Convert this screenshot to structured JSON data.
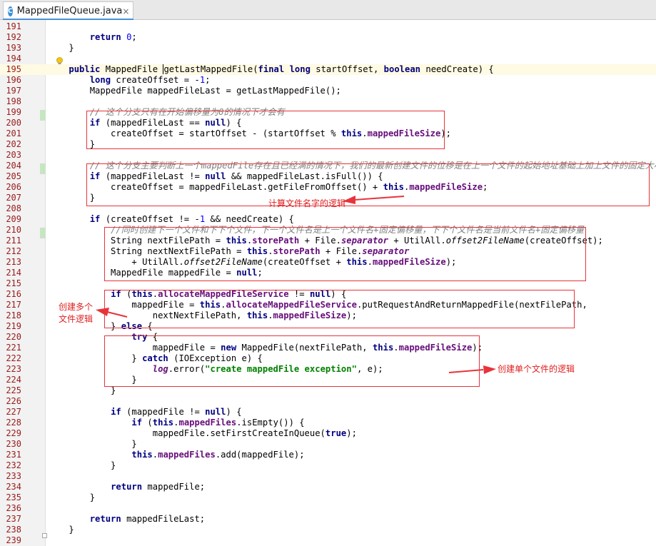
{
  "tab": {
    "label": "MappedFileQueue.java",
    "icon": "class-c-icon",
    "close": "×",
    "icon_letter": "C"
  },
  "colors": {
    "keyword": "#000080",
    "field": "#660e7a",
    "string": "#008000",
    "number": "#0000ff",
    "comment": "#808080",
    "annotation_red": "#e8333a"
  },
  "lines": [
    {
      "n": "191",
      "html": ""
    },
    {
      "n": "192",
      "html": "        <span class='kw'>return</span> <span class='num'>0</span>;"
    },
    {
      "n": "193",
      "html": "    }"
    },
    {
      "n": "194",
      "html": ""
    },
    {
      "n": "195",
      "html": "    <span class='kw'>public</span> MappedFile <span style='border-left:1px solid #000'>getLastMappedFile</span>(<span class='kw'>final long</span> startOffset, <span class='kw'>boolean</span> needCreate) {"
    },
    {
      "n": "196",
      "html": "        <span class='kw'>long</span> createOffset = -<span class='num'>1</span>;"
    },
    {
      "n": "197",
      "html": "        MappedFile mappedFileLast = getLastMappedFile();"
    },
    {
      "n": "198",
      "html": ""
    },
    {
      "n": "199",
      "html": "        <span class='cmt'>// 这个分支只有在开始偏移量为0的情况下才会有</span>"
    },
    {
      "n": "200",
      "html": "        <span class='kw'>if</span> (mappedFileLast == <span class='kw'>null</span>) {"
    },
    {
      "n": "201",
      "html": "            createOffset = startOffset - (startOffset % <span class='kw'>this</span>.<span class='fld'>mappedFileSize</span>);"
    },
    {
      "n": "202",
      "html": "        }"
    },
    {
      "n": "203",
      "html": ""
    },
    {
      "n": "204",
      "html": "        <span class='cmt'>// 这个分支主要判断上一个mappedFile存在且已经满的情况下，我们的最新创建文件的位移是在上一个文件的起始地址基础上加上文件的固定大小</span>"
    },
    {
      "n": "205",
      "html": "        <span class='kw'>if</span> (mappedFileLast != <span class='kw'>null</span> &amp;&amp; mappedFileLast.isFull()) {"
    },
    {
      "n": "206",
      "html": "            createOffset = mappedFileLast.getFileFromOffset() + <span class='kw'>this</span>.<span class='fld'>mappedFileSize</span>;"
    },
    {
      "n": "207",
      "html": "        }"
    },
    {
      "n": "208",
      "html": ""
    },
    {
      "n": "209",
      "html": "        <span class='kw'>if</span> (createOffset != -<span class='num'>1</span> &amp;&amp; needCreate) {"
    },
    {
      "n": "210",
      "html": "            <span class='cmt'>//同时创建下一个文件和下下个文件，下一个文件名是上一个文件名+固定偏移量，下下个文件名是当前文件名+固定偏移量</span>"
    },
    {
      "n": "211",
      "html": "            String nextFilePath = <span class='kw'>this</span>.<span class='fld'>storePath</span> + File.<span class='fld ital'>separator</span> + UtilAll.<span class='ital'>offset2FileName</span>(createOffset);"
    },
    {
      "n": "212",
      "html": "            String nextNextFilePath = <span class='kw'>this</span>.<span class='fld'>storePath</span> + File.<span class='fld ital'>separator</span>"
    },
    {
      "n": "213",
      "html": "                + UtilAll.<span class='ital'>offset2FileName</span>(createOffset + <span class='kw'>this</span>.<span class='fld'>mappedFileSize</span>);"
    },
    {
      "n": "214",
      "html": "            MappedFile mappedFile = <span class='kw'>null</span>;"
    },
    {
      "n": "215",
      "html": ""
    },
    {
      "n": "216",
      "html": "            <span class='kw'>if</span> (<span class='kw'>this</span>.<span class='fld'>allocateMappedFileService</span> != <span class='kw'>null</span>) {"
    },
    {
      "n": "217",
      "html": "                mappedFile = <span class='kw'>this</span>.<span class='fld'>allocateMappedFileService</span>.putRequestAndReturnMappedFile(nextFilePath,"
    },
    {
      "n": "218",
      "html": "                    nextNextFilePath, <span class='kw'>this</span>.<span class='fld'>mappedFileSize</span>);"
    },
    {
      "n": "219",
      "html": "            } <span class='kw'>else</span> {"
    },
    {
      "n": "220",
      "html": "                <span class='kw'>try</span> {"
    },
    {
      "n": "221",
      "html": "                    mappedFile = <span class='kw'>new</span> MappedFile(nextFilePath, <span class='kw'>this</span>.<span class='fld'>mappedFileSize</span>);"
    },
    {
      "n": "222",
      "html": "                } <span class='kw'>catch</span> (IOException e) {"
    },
    {
      "n": "223",
      "html": "                    <span class='fld ital'>log</span>.error(<span class='str'>\"create mappedFile exception\"</span>, e);"
    },
    {
      "n": "224",
      "html": "                }"
    },
    {
      "n": "225",
      "html": "            }"
    },
    {
      "n": "226",
      "html": ""
    },
    {
      "n": "227",
      "html": "            <span class='kw'>if</span> (mappedFile != <span class='kw'>null</span>) {"
    },
    {
      "n": "228",
      "html": "                <span class='kw'>if</span> (<span class='kw'>this</span>.<span class='fld'>mappedFiles</span>.isEmpty()) {"
    },
    {
      "n": "229",
      "html": "                    mappedFile.setFirstCreateInQueue(<span class='kw'>true</span>);"
    },
    {
      "n": "230",
      "html": "                }"
    },
    {
      "n": "231",
      "html": "                <span class='kw'>this</span>.<span class='fld'>mappedFiles</span>.add(mappedFile);"
    },
    {
      "n": "232",
      "html": "            }"
    },
    {
      "n": "233",
      "html": ""
    },
    {
      "n": "234",
      "html": "            <span class='kw'>return</span> mappedFile;"
    },
    {
      "n": "235",
      "html": "        }"
    },
    {
      "n": "236",
      "html": ""
    },
    {
      "n": "237",
      "html": "        <span class='kw'>return</span> mappedFileLast;"
    },
    {
      "n": "238",
      "html": "    }"
    },
    {
      "n": "239",
      "html": ""
    }
  ],
  "annotations": {
    "filename_logic": "计算文件名字的逻辑",
    "multi_file_line1": "创建多个",
    "multi_file_line2": "文件逻辑",
    "single_file": "创建单个文件的逻辑"
  }
}
